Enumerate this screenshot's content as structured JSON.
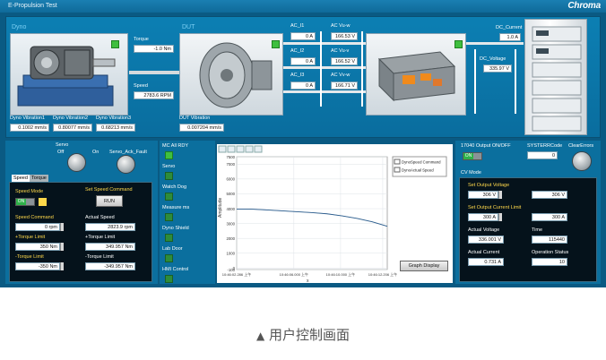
{
  "window": {
    "title": "E-Propulsion Test",
    "brand": "Chroma"
  },
  "top": {
    "dyno_label": "Dyno",
    "dut_label": "DUT",
    "torque_label": "Torque",
    "torque_value": "-1.0 Nm",
    "speed_label": "Speed",
    "speed_value": "2783.6 RPM",
    "dyno_vibration": [
      {
        "label": "Dyno Vibration1",
        "value": "0.1002 mm/s"
      },
      {
        "label": "Dyno Vibration2",
        "value": "0.80077 mm/s"
      },
      {
        "label": "Dyno Vibration3",
        "value": "0.68213 mm/s"
      }
    ],
    "dut_vibration_label": "DUT Vibration",
    "dut_vibration_value": "0.007204 mm/s",
    "ac_currents": [
      {
        "label": "AC_I1",
        "value": "0 A"
      },
      {
        "label": "AC_I2",
        "value": "0 A"
      },
      {
        "label": "AC_I3",
        "value": "0 A"
      }
    ],
    "ac_voltages": [
      {
        "label": "AC Vu-w",
        "value": "166.53 V"
      },
      {
        "label": "AC Vu-v",
        "value": "166.52 V"
      },
      {
        "label": "AC Vv-w",
        "value": "166.71 V"
      }
    ],
    "dc_current_label": "DC_Current",
    "dc_current_value": "1.0 A",
    "dc_voltage_label": "DC_Voltage",
    "dc_voltage_value": "335.97 V"
  },
  "left_panel": {
    "servo_label": "Servo",
    "servo_off": "Off",
    "servo_on": "On",
    "servo_fault_label": "Servo_Ack_Fault",
    "tabs": [
      "Speed",
      "Torque"
    ],
    "speed_mode_label": "Speed Mode",
    "speed_mode_toggle": "ON",
    "set_speed_cmd_label": "Set Speed Command",
    "run_label": "RUN",
    "speed_command_label": "Speed Command",
    "speed_command_value": "0 rpm",
    "actual_speed_label": "Actual Speed",
    "actual_speed_value": "2823.9 rpm",
    "pos_torque_limit_label": "+Torque Limit",
    "pos_torque_limit_value": "350 Nm",
    "actual_pos_torque_label": "+Torque Limit",
    "actual_pos_torque_value": "349.957 Nm",
    "neg_torque_limit_label": "-Torque Limit",
    "neg_torque_limit_value": "-350 Nm",
    "actual_neg_torque_label": "-Torque Limit",
    "actual_neg_torque_value": "-349.957 Nm"
  },
  "status_column": {
    "header": "MC All RDY",
    "items": [
      "Servo",
      "Watch Dog",
      "Measure ms",
      "Dyno Shield",
      "Lab Door",
      "HMI Control"
    ]
  },
  "chart_panel": {
    "graph_display_label": "Graph Display",
    "ylabel": "Amplitude",
    "xlabel": "x",
    "legend": [
      "DynoSpeed Command",
      "DynoActual Speed"
    ]
  },
  "chart_data": {
    "type": "line",
    "ylabel": "Amplitude",
    "xlabel": "x",
    "ylim": [
      -100,
      7500
    ],
    "yticks": [
      7500,
      7000,
      6000,
      5000,
      4000,
      3000,
      2000,
      1000,
      0,
      -100
    ],
    "xtick_labels": [
      "10:46:02.286 上午",
      "10:46:06.000 上午",
      "10:46:10.000 上午",
      "10:46:12.206 上午"
    ],
    "x": [
      0,
      0.1,
      0.2,
      0.3,
      0.4,
      0.5,
      0.6,
      0.7,
      0.8,
      0.9,
      1.0
    ],
    "series": [
      {
        "name": "DynoSpeed Command",
        "values": [
          3980,
          3970,
          3920,
          3860,
          3800,
          3740,
          3660,
          3520,
          3350,
          3120,
          2820
        ]
      },
      {
        "name": "DynoActual Speed",
        "values": [
          3975,
          3965,
          3915,
          3855,
          3795,
          3735,
          3655,
          3515,
          3345,
          3115,
          2815
        ]
      }
    ],
    "grid": true,
    "legend_position": "top-right"
  },
  "right_panel": {
    "output_label": "17040 Output ON/OFF",
    "output_toggle": "ON",
    "syserr_label": "SYSTERRCode",
    "syserr_value": "0",
    "clear_errors_label": "ClearErrors",
    "cv_mode_label": "CV Mode",
    "set_output_voltage_label": "Set Output Voltage",
    "set_output_voltage_value": "306 V",
    "set_output_voltage_readback": "306 V",
    "set_output_current_label": "Set Output Current Limit",
    "set_output_current_value": "300 A",
    "set_output_current_readback": "300 A",
    "actual_voltage_label": "Actual Voltage",
    "actual_voltage_value": "336.001 V",
    "time_label": "Time",
    "time_value": "115440",
    "actual_current_label": "Actual Current",
    "actual_current_value": "0.731 A",
    "operation_status_label": "Operation Status",
    "operation_status_value": "10"
  },
  "caption": {
    "marker": "▲",
    "text": "用户控制画面"
  },
  "colors": {
    "accent": "#0a5a83",
    "led": "#3fbf3f",
    "highlight": "#ffd84a"
  }
}
